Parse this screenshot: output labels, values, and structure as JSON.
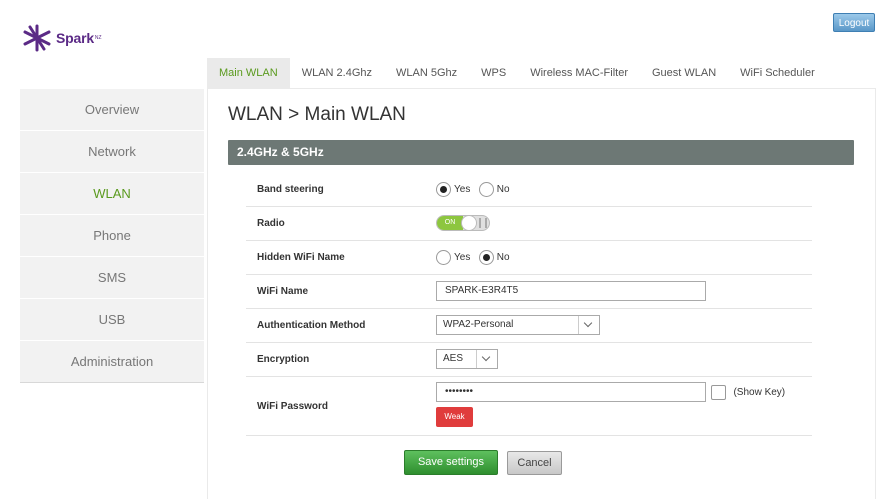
{
  "brand": {
    "name": "Spark",
    "suffix": "NZ",
    "color": "#5b2a86"
  },
  "header": {
    "logout_label": "Logout"
  },
  "tabs": [
    {
      "label": "Main WLAN",
      "active": true
    },
    {
      "label": "WLAN 2.4Ghz"
    },
    {
      "label": "WLAN 5Ghz"
    },
    {
      "label": "WPS"
    },
    {
      "label": "Wireless MAC-Filter"
    },
    {
      "label": "Guest WLAN"
    },
    {
      "label": "WiFi Scheduler"
    }
  ],
  "sidebar": {
    "items": [
      {
        "label": "Overview"
      },
      {
        "label": "Network"
      },
      {
        "label": "WLAN",
        "active": true
      },
      {
        "label": "Phone"
      },
      {
        "label": "SMS"
      },
      {
        "label": "USB"
      },
      {
        "label": "Administration"
      }
    ]
  },
  "page": {
    "title": "WLAN > Main WLAN",
    "section": "2.4GHz & 5GHz"
  },
  "form": {
    "band_steering": {
      "label": "Band steering",
      "yes": "Yes",
      "no": "No",
      "selected": "Yes"
    },
    "radio": {
      "label": "Radio",
      "state": "ON"
    },
    "hidden_name": {
      "label": "Hidden WiFi Name",
      "yes": "Yes",
      "no": "No",
      "selected": "No"
    },
    "wifi_name": {
      "label": "WiFi Name",
      "value": "SPARK-E3R4T5"
    },
    "auth_method": {
      "label": "Authentication Method",
      "value": "WPA2-Personal"
    },
    "encryption": {
      "label": "Encryption",
      "value": "AES"
    },
    "password": {
      "label": "WiFi Password",
      "value": "••••••••",
      "show_key": "(Show Key)",
      "strength": "Weak"
    }
  },
  "actions": {
    "save": "Save settings",
    "cancel": "Cancel"
  },
  "colors": {
    "accent_green": "#5a9a1e",
    "section_bar": "#6d7875",
    "weak_red": "#e03c3c",
    "save_green": "#3fa83f"
  }
}
